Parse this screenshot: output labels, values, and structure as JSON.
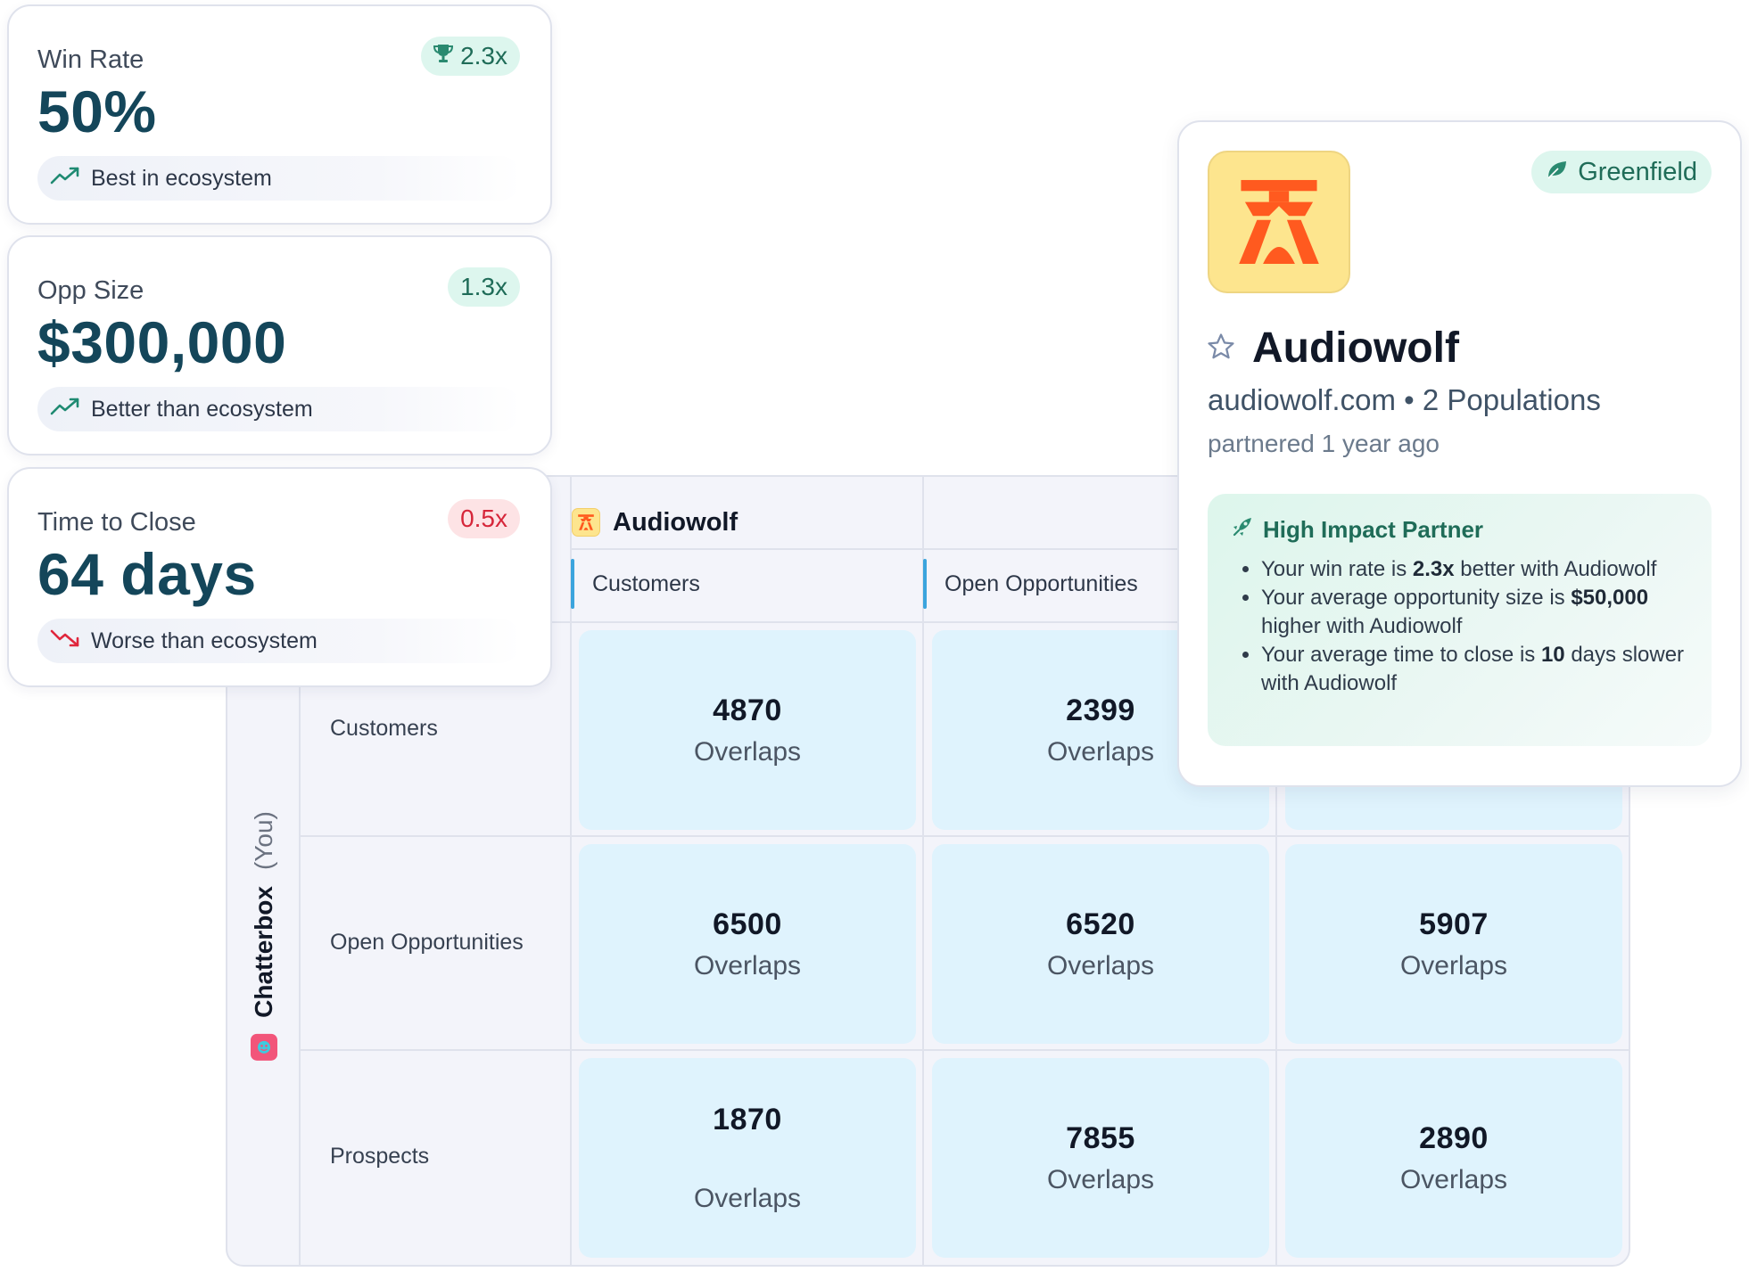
{
  "metrics": [
    {
      "title": "Win Rate",
      "value": "50%",
      "badge": "2.3x",
      "badge_tone": "good",
      "badge_icon": "trophy-icon",
      "footer": "Best in ecosystem",
      "trend": "up"
    },
    {
      "title": "Opp Size",
      "value": "$300,000",
      "badge": "1.3x",
      "badge_tone": "good",
      "badge_icon": "",
      "footer": "Better than ecosystem",
      "trend": "up"
    },
    {
      "title": "Time to Close",
      "value": "64 days",
      "badge": "0.5x",
      "badge_tone": "bad",
      "badge_icon": "",
      "footer": "Worse than ecosystem",
      "trend": "down"
    }
  ],
  "matrix": {
    "partner_name": "Audiowolf",
    "you_name": "Chatterbox",
    "you_suffix": "(You)",
    "columns": [
      "Customers",
      "Open Opportunities"
    ],
    "rows": [
      "Customers",
      "Open Opportunities",
      "Prospects"
    ],
    "overlap_label": "Overlaps",
    "cells": [
      [
        "4870",
        "2399",
        ""
      ],
      [
        "6500",
        "6520",
        "5907"
      ],
      [
        "1870",
        "7855",
        "2890"
      ]
    ]
  },
  "partner_card": {
    "name": "Audiowolf",
    "domain": "audiowolf.com",
    "separator": "•",
    "populations": "2 Populations",
    "partnered": "partnered 1 year ago",
    "tag": "Greenfield",
    "impact_title": "High Impact Partner",
    "impact_items": [
      {
        "pre": "Your win rate is ",
        "bold": "2.3x",
        "post": " better with Audiowolf"
      },
      {
        "pre": "Your average opportunity size is ",
        "bold": "$50,000",
        "post": " higher with Audiowolf"
      },
      {
        "pre": "Your average time to close is ",
        "bold": "10",
        "post": " days slower with Audiowolf"
      }
    ]
  },
  "colors": {
    "accent_teal": "#14465a",
    "good_green": "#1f6c58",
    "bad_red": "#d6263a",
    "cell_blue": "#dff3fd",
    "audiowolf_yellow": "#fde58e",
    "audiowolf_orange": "#ff5a1f"
  }
}
